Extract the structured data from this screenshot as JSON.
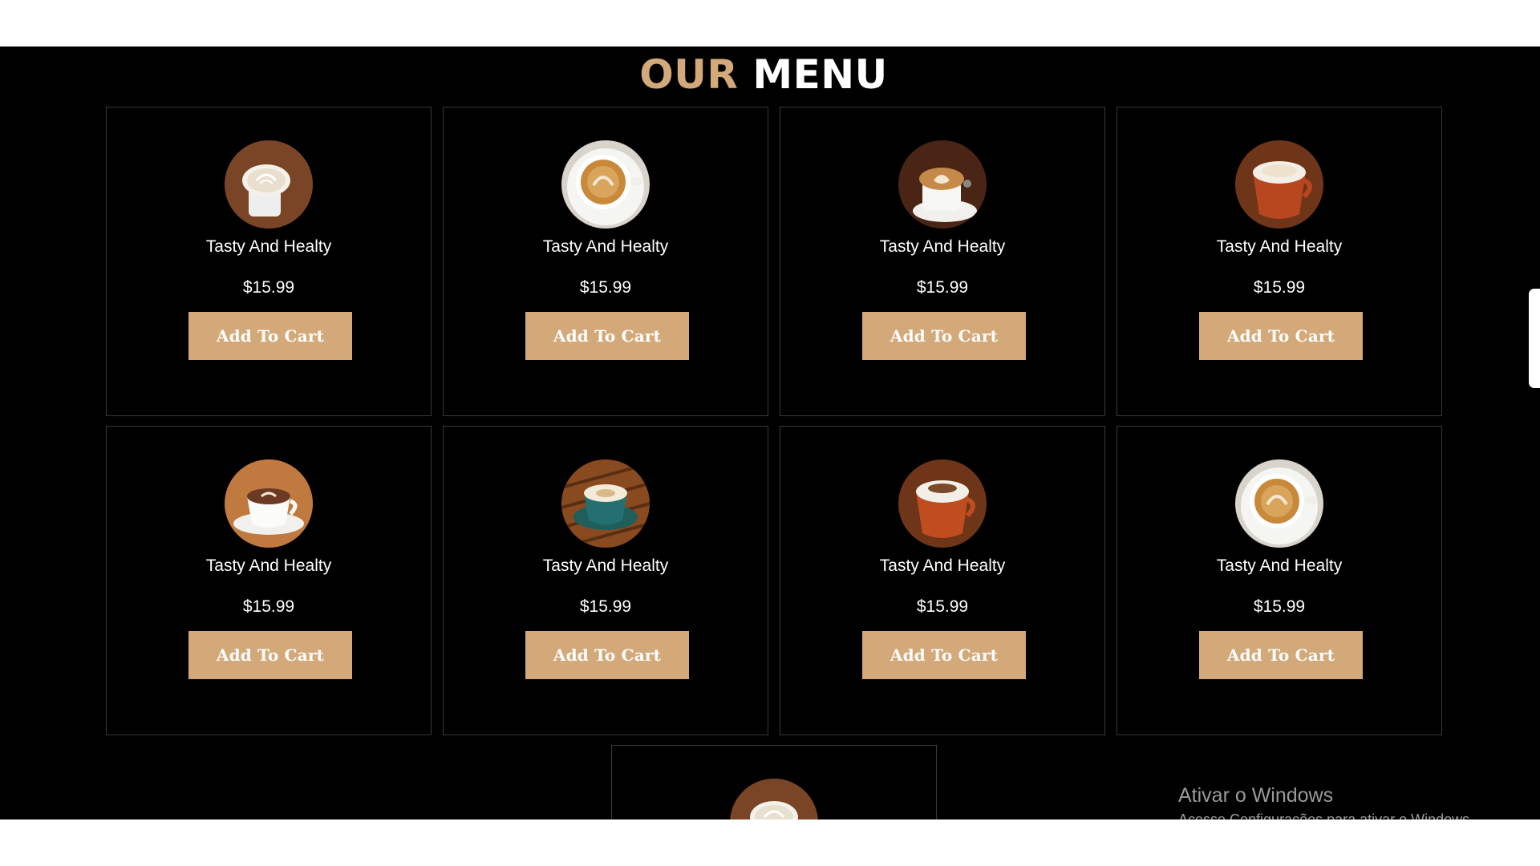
{
  "menu": {
    "title_accent": "OUR",
    "title_main": "MENU"
  },
  "items": [
    {
      "name": "Tasty And Healty",
      "price": "$15.99",
      "button": "Add To Cart",
      "icon": "coffee-latte-mug-icon"
    },
    {
      "name": "Tasty And Healty",
      "price": "$15.99",
      "button": "Add To Cart",
      "icon": "coffee-cup-topview-icon"
    },
    {
      "name": "Tasty And Healty",
      "price": "$15.99",
      "button": "Add To Cart",
      "icon": "coffee-latte-art-icon"
    },
    {
      "name": "Tasty And Healty",
      "price": "$15.99",
      "button": "Add To Cart",
      "icon": "coffee-red-cup-icon"
    },
    {
      "name": "Tasty And Healty",
      "price": "$15.99",
      "button": "Add To Cart",
      "icon": "coffee-white-cup-icon"
    },
    {
      "name": "Tasty And Healty",
      "price": "$15.99",
      "button": "Add To Cart",
      "icon": "coffee-teal-cup-icon"
    },
    {
      "name": "Tasty And Healty",
      "price": "$15.99",
      "button": "Add To Cart",
      "icon": "coffee-red-cup-icon"
    },
    {
      "name": "Tasty And Healty",
      "price": "$15.99",
      "button": "Add To Cart",
      "icon": "coffee-cup-topview-icon"
    }
  ],
  "watermark": {
    "title": "Ativar o Windows",
    "subtitle": "Acesse Configurações para ativar o Windows."
  },
  "colors": {
    "accent": "#d3a97a",
    "background": "#000000",
    "card_border": "#3a3a3a"
  }
}
